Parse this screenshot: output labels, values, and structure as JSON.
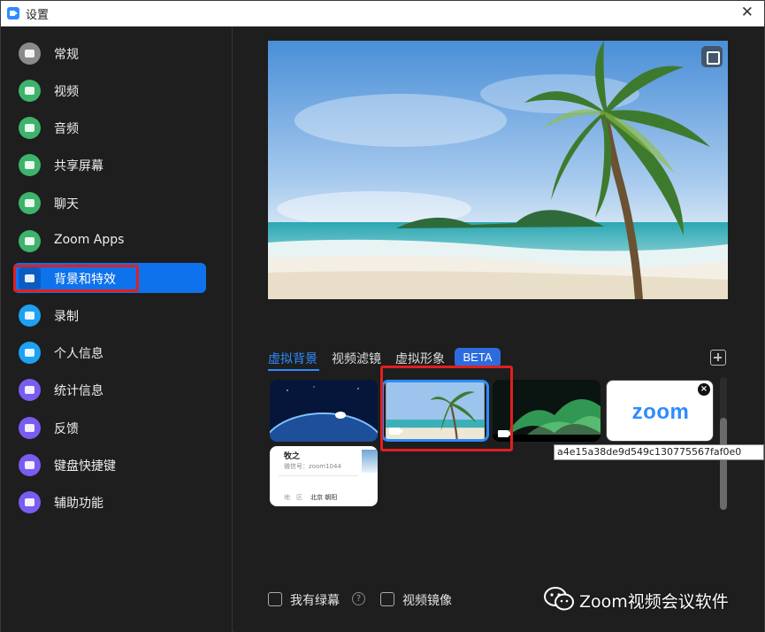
{
  "window": {
    "title": "设置"
  },
  "sidebar": {
    "items": [
      {
        "label": "常规",
        "icon": "gear-icon",
        "color": "#8a8a8a"
      },
      {
        "label": "视频",
        "icon": "video-camera-icon",
        "color": "#3db36b"
      },
      {
        "label": "音频",
        "icon": "headphones-icon",
        "color": "#3db36b"
      },
      {
        "label": "共享屏幕",
        "icon": "share-screen-icon",
        "color": "#3db36b"
      },
      {
        "label": "聊天",
        "icon": "chat-bubble-icon",
        "color": "#3db36b"
      },
      {
        "label": "Zoom Apps",
        "icon": "apps-icon",
        "color": "#3db36b"
      },
      {
        "label": "背景和特效",
        "icon": "background-person-icon",
        "color": "#0e72ed",
        "active": true
      },
      {
        "label": "录制",
        "icon": "record-icon",
        "color": "#1da1f2"
      },
      {
        "label": "个人信息",
        "icon": "profile-icon",
        "color": "#1da1f2"
      },
      {
        "label": "统计信息",
        "icon": "statistics-icon",
        "color": "#7b5cf0"
      },
      {
        "label": "反馈",
        "icon": "feedback-smile-icon",
        "color": "#7b5cf0"
      },
      {
        "label": "键盘快捷键",
        "icon": "keyboard-icon",
        "color": "#7b5cf0"
      },
      {
        "label": "辅助功能",
        "icon": "accessibility-icon",
        "color": "#7b5cf0"
      }
    ]
  },
  "main": {
    "tabs": [
      {
        "label": "虚拟背景",
        "active": true
      },
      {
        "label": "视频滤镜"
      },
      {
        "label": "虚拟形象"
      }
    ],
    "beta_label": "BETA",
    "tooltip": "a4e15a38de9d549c130775567faf0e0",
    "zoom_logo_text": "zoom",
    "card": {
      "name": "牧之",
      "wechat_id": "微信号：zoom1044",
      "region_label": "地　区",
      "region_value": "北京 朝阳"
    },
    "checkboxes": {
      "green_screen": "我有绿幕",
      "mirror_video": "视频镜像"
    },
    "help_glyph": "?"
  },
  "watermark": {
    "text": "Zoom视频会议软件"
  },
  "colors": {
    "accent": "#2d8cff",
    "highlight": "#e02020",
    "active_nav": "#0e72ed"
  }
}
